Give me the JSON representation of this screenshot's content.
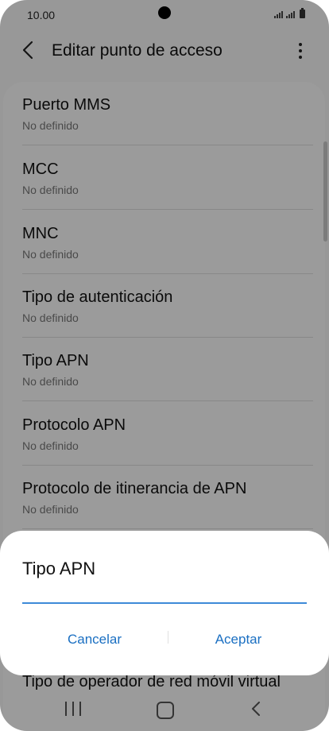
{
  "status_bar": {
    "time": "10.00"
  },
  "header": {
    "title": "Editar punto de acceso",
    "back_icon": "back-arrow-icon",
    "more_icon": "more-options-icon"
  },
  "list": {
    "items": [
      {
        "title": "Puerto MMS",
        "summary": "No definido"
      },
      {
        "title": "MCC",
        "summary": "No definido"
      },
      {
        "title": "MNC",
        "summary": "No definido"
      },
      {
        "title": "Tipo de autenticación",
        "summary": "No definido"
      },
      {
        "title": "Tipo APN",
        "summary": "No definido"
      },
      {
        "title": "Protocolo APN",
        "summary": "No definido"
      },
      {
        "title": "Protocolo de itinerancia de APN",
        "summary": "No definido"
      },
      {
        "title": "Tipo de operador de red móvil virtual",
        "summary": ""
      }
    ]
  },
  "dialog": {
    "title": "Tipo APN",
    "input_value": "",
    "cancel_label": "Cancelar",
    "accept_label": "Aceptar"
  },
  "colors": {
    "accent": "#1a6fc2",
    "input_underline": "#3d8ad8"
  }
}
